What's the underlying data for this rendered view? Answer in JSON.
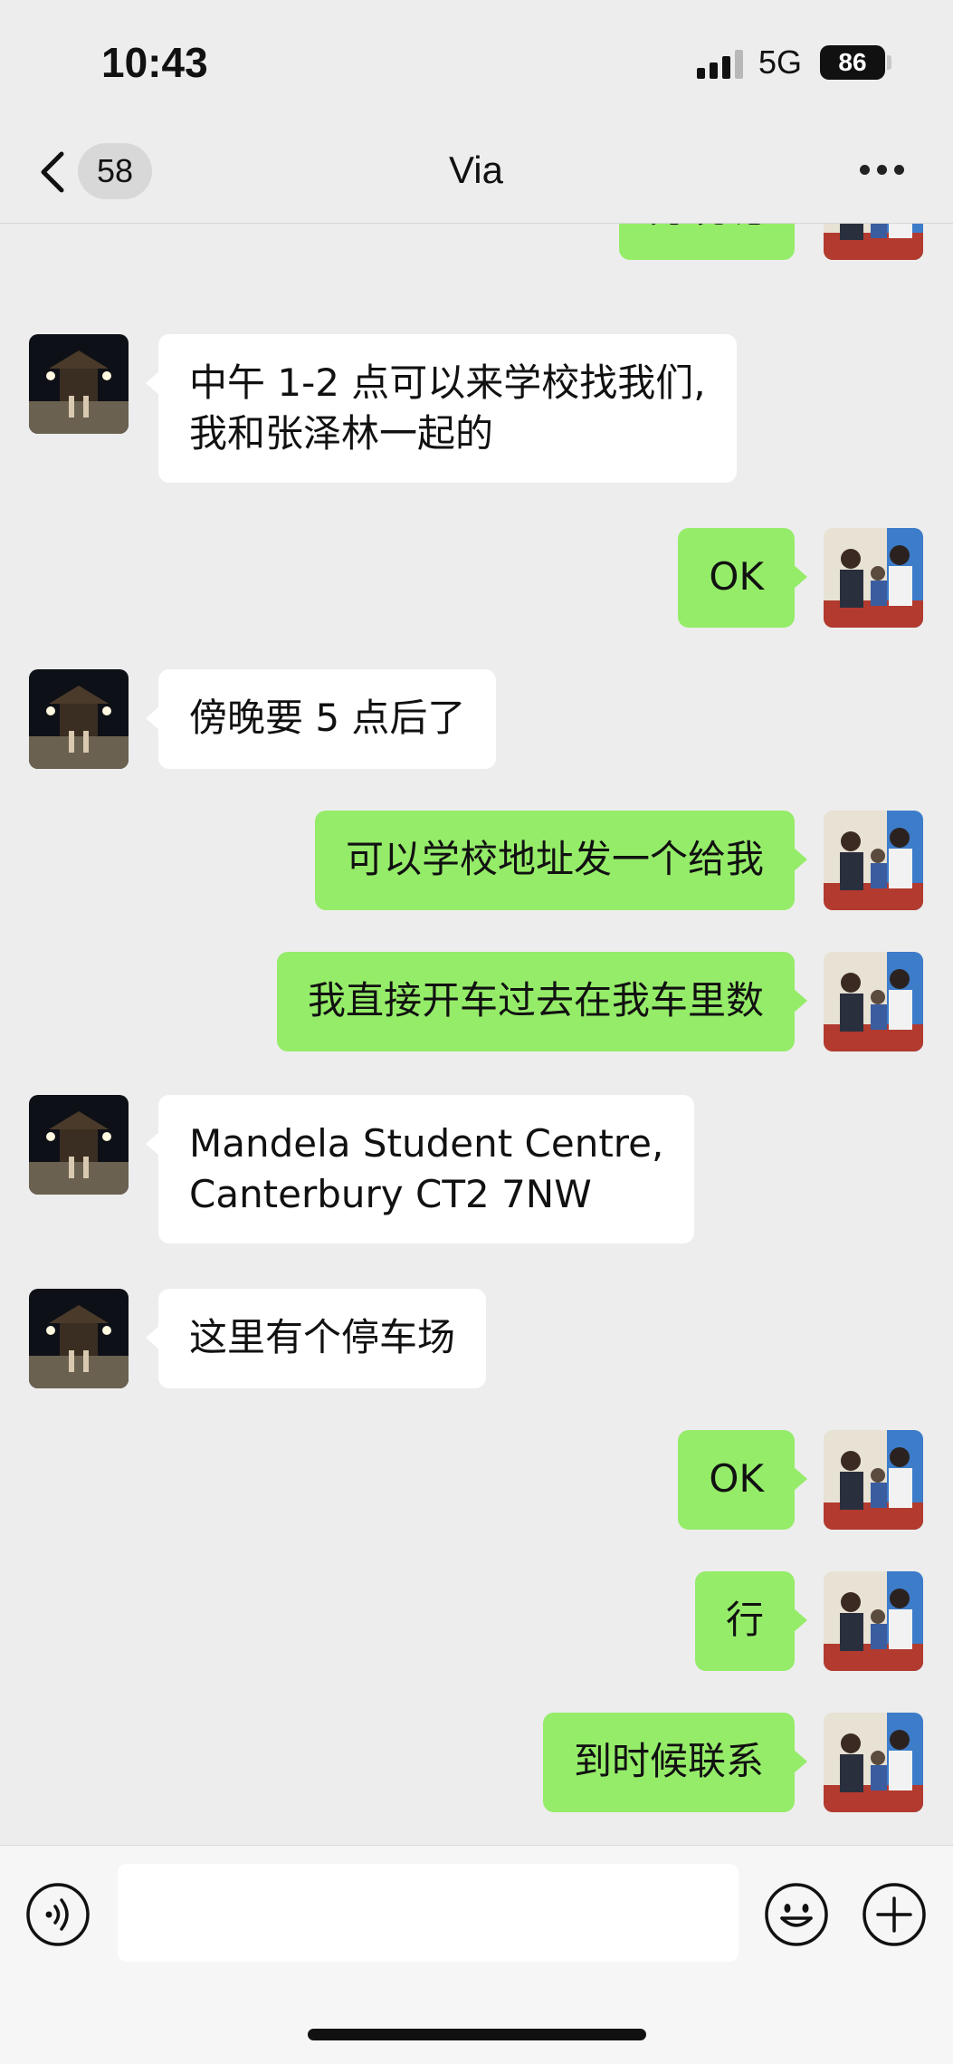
{
  "status_bar": {
    "time": "10:43",
    "network": "5G",
    "battery": "86"
  },
  "nav": {
    "unread_count": "58",
    "title": "Via"
  },
  "messages": [
    {
      "side": "out",
      "lines": [
        "旁晚呢"
      ]
    },
    {
      "side": "in",
      "lines": [
        "中午 1-2 点可以来学校找我们,",
        "我和张泽林一起的"
      ]
    },
    {
      "side": "out",
      "lines": [
        "OK"
      ]
    },
    {
      "side": "in",
      "lines": [
        "傍晚要 5 点后了"
      ]
    },
    {
      "side": "out",
      "lines": [
        "可以学校地址发一个给我"
      ]
    },
    {
      "side": "out",
      "lines": [
        "我直接开车过去在我车里数"
      ]
    },
    {
      "side": "in",
      "lines": [
        "Mandela Student Centre,",
        "Canterbury CT2 7NW"
      ]
    },
    {
      "side": "in",
      "lines": [
        "这里有个停车场"
      ]
    },
    {
      "side": "out",
      "lines": [
        "OK"
      ]
    },
    {
      "side": "out",
      "lines": [
        "行"
      ]
    },
    {
      "side": "out",
      "lines": [
        "到时候联系"
      ]
    }
  ],
  "input": {
    "placeholder": ""
  },
  "icons": {
    "back": "chevron-left-icon",
    "more": "more-horizontal-icon",
    "voice": "voice-icon",
    "emoji": "emoji-icon",
    "plus": "plus-icon"
  },
  "colors": {
    "background": "#ededed",
    "sent_bubble": "#95ec69",
    "received_bubble": "#ffffff"
  }
}
